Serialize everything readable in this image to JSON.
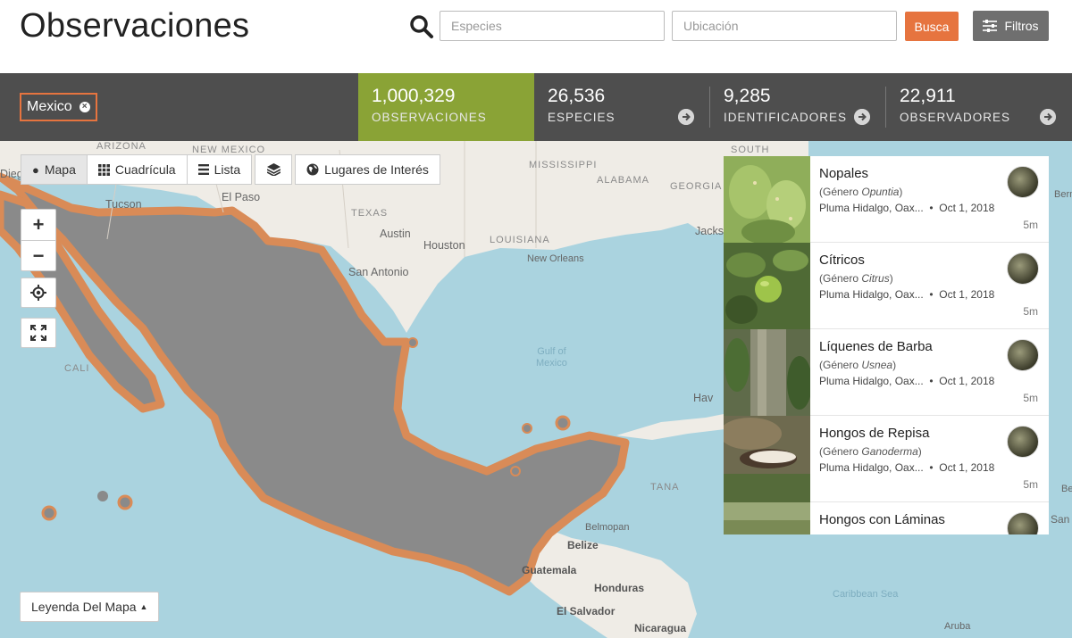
{
  "header": {
    "title": "Observaciones",
    "species_placeholder": "Especies",
    "place_placeholder": "Ubicación",
    "search_label": "Busca",
    "filters_label": "Filtros"
  },
  "stats": {
    "place_chip": "Mexico",
    "items": [
      {
        "number": "1,000,329",
        "label": "OBSERVACIONES"
      },
      {
        "number": "26,536",
        "label": "ESPECIES"
      },
      {
        "number": "9,285",
        "label": "IDENTIFICADORES"
      },
      {
        "number": "22,911",
        "label": "OBSERVADORES"
      }
    ]
  },
  "map": {
    "tabs": [
      {
        "label": "Mapa",
        "icon": "map-marker-icon"
      },
      {
        "label": "Cuadrícula",
        "icon": "grid-icon"
      },
      {
        "label": "Lista",
        "icon": "list-icon"
      }
    ],
    "places_label": "Lugares de Interés",
    "zoom_in": "+",
    "zoom_out": "−",
    "legend_label": "Leyenda Del Mapa",
    "labels": {
      "arizona": "ARIZONA",
      "new_mexico": "NEW MEXICO",
      "mississippi": "MISSISSIPPI",
      "alabama": "ALABAMA",
      "georgia": "GEORGIA",
      "south": "SOUTH",
      "texas": "TEXAS",
      "louisiana": "LOUISIANA",
      "cali": "CALI",
      "diego": "Diego",
      "tucson": "Tucson",
      "el_paso": "El Paso",
      "austin": "Austin",
      "houston": "Houston",
      "san_antonio": "San Antonio",
      "new_orleans": "New Orleans",
      "jacks": "Jacks",
      "gulf": "Gulf of\nMexico",
      "hav": "Hav",
      "belize": "Belize",
      "belmopan": "Belmopan",
      "guatemala": "Guatemala",
      "honduras": "Honduras",
      "el_salvador": "El Salvador",
      "nicaragua": "Nicaragua",
      "caribbean": "Caribbean Sea",
      "aruba": "Aruba",
      "berm": "Berm",
      "ber": "Ber",
      "san": "San",
      "tana": "TANA"
    }
  },
  "observations": [
    {
      "name": "Nopales",
      "genus_prefix": "Género",
      "genus": "Opuntia",
      "place": "Pluma Hidalgo, Oax...",
      "date": "Oct 1, 2018",
      "time": "5m"
    },
    {
      "name": "Cítricos",
      "genus_prefix": "Género",
      "genus": "Citrus",
      "place": "Pluma Hidalgo, Oax...",
      "date": "Oct 1, 2018",
      "time": "5m"
    },
    {
      "name": "Líquenes de Barba",
      "genus_prefix": "Género",
      "genus": "Usnea",
      "place": "Pluma Hidalgo, Oax...",
      "date": "Oct 1, 2018",
      "time": "5m"
    },
    {
      "name": "Hongos de Repisa",
      "genus_prefix": "Género",
      "genus": "Ganoderma",
      "place": "Pluma Hidalgo, Oax...",
      "date": "Oct 1, 2018",
      "time": "5m"
    },
    {
      "name": "Hongos con Láminas",
      "genus_prefix": "",
      "genus": "",
      "place": "",
      "date": "",
      "time": ""
    }
  ],
  "colors": {
    "accent": "#e6743f",
    "stats_active": "#8aa336",
    "stats_bar": "#4e4e4e",
    "water": "#aad3df",
    "land": "#efece6",
    "observation_density": "#777777"
  }
}
